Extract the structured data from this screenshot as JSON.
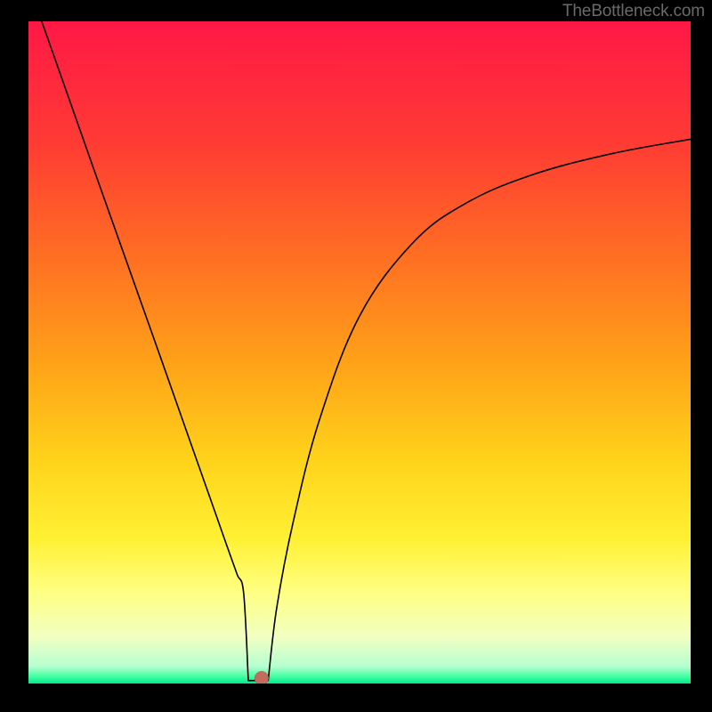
{
  "watermark": "TheBottleneck.com",
  "chart_data": {
    "type": "line",
    "title": "",
    "xlabel": "",
    "ylabel": "",
    "xlim": [
      0,
      100
    ],
    "ylim": [
      0,
      100
    ],
    "grid": false,
    "legend": false,
    "background_gradient_stops": [
      {
        "offset": 0.0,
        "color": "#ff1846"
      },
      {
        "offset": 0.18,
        "color": "#ff3a34"
      },
      {
        "offset": 0.36,
        "color": "#ff7022"
      },
      {
        "offset": 0.52,
        "color": "#ffa318"
      },
      {
        "offset": 0.66,
        "color": "#ffd21a"
      },
      {
        "offset": 0.78,
        "color": "#fff033"
      },
      {
        "offset": 0.86,
        "color": "#ffff80"
      },
      {
        "offset": 0.93,
        "color": "#f2ffc2"
      },
      {
        "offset": 0.974,
        "color": "#b6ffd1"
      },
      {
        "offset": 0.99,
        "color": "#3effa0"
      },
      {
        "offset": 1.0,
        "color": "#00e88b"
      }
    ],
    "series": [
      {
        "name": "bottleneck-curve",
        "x": [
          2,
          5,
          10,
          15,
          20,
          25,
          28,
          30,
          31.5,
          32.5,
          34,
          34.5,
          35,
          35.5,
          36,
          37.5,
          40,
          44,
          50,
          58,
          66,
          76,
          88,
          100
        ],
        "y": [
          100,
          91.5,
          77.3,
          63.2,
          49.1,
          34.9,
          26.4,
          20.7,
          16.5,
          13.6,
          9.4,
          2.0,
          0.5,
          0.5,
          2.0,
          11.5,
          24.5,
          40.0,
          55.5,
          66.5,
          72.5,
          76.8,
          80.0,
          82.2
        ]
      }
    ],
    "marker": {
      "x": 35.2,
      "y": 0.8,
      "color": "#c46a5f",
      "r": 1.05
    },
    "flat_floor": {
      "x0": 33.2,
      "x1": 36.2,
      "y": 0.45
    }
  }
}
